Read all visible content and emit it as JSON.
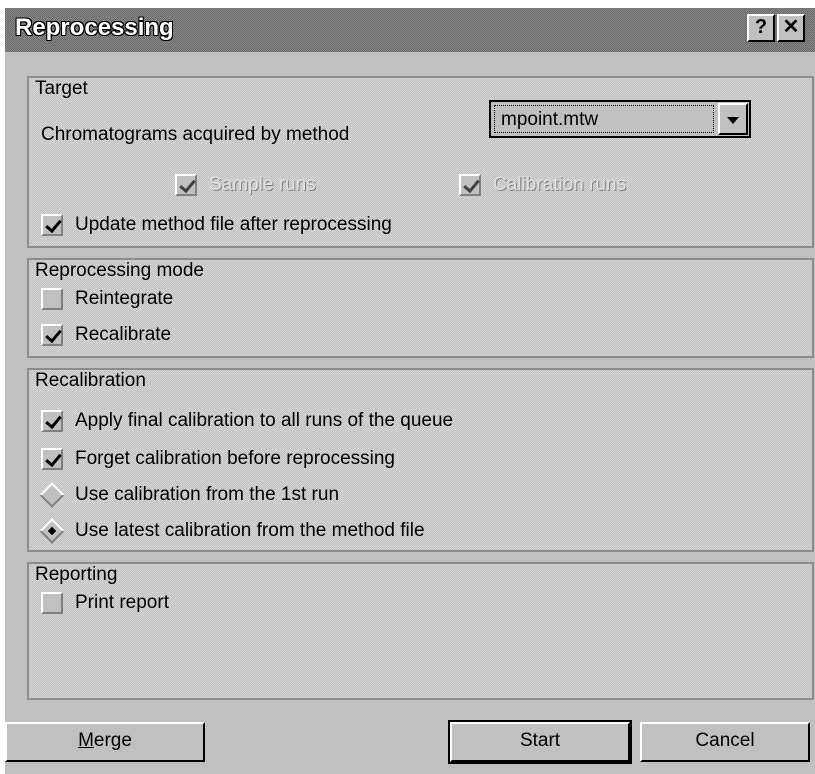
{
  "window": {
    "title": "Reprocessing",
    "help_label": "?",
    "close_label": "✕"
  },
  "target": {
    "title": "Target",
    "chromatograms_label": "Chromatograms acquired by method",
    "method_value": "mpoint.mtw",
    "sample_runs_label": "Sample runs",
    "calibration_runs_label": "Calibration runs",
    "update_label": "Update method file after reprocessing"
  },
  "mode": {
    "title": "Reprocessing mode",
    "reintegrate_label": "Reintegrate",
    "recalibrate_label": "Recalibrate"
  },
  "recal": {
    "title": "Recalibration",
    "apply_label": "Apply final calibration to all runs of the queue",
    "forget_label": "Forget calibration before reprocessing",
    "use_first_label": "Use calibration from the 1st run",
    "use_latest_label": "Use latest calibration from the method file"
  },
  "reporting": {
    "title": "Reporting",
    "print_label": "Print report"
  },
  "buttons": {
    "merge_first": "M",
    "merge_rest": "erge",
    "start": "Start",
    "cancel": "Cancel"
  },
  "state": {
    "sample_runs": true,
    "calibration_runs": true,
    "update_method": true,
    "reintegrate": false,
    "recalibrate": true,
    "apply_final": true,
    "forget_calibration": true,
    "calibration_source": "latest",
    "print_report": false
  }
}
